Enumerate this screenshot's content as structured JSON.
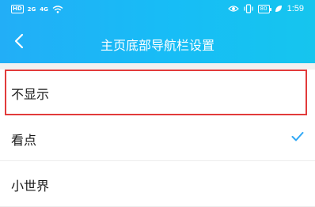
{
  "status_bar": {
    "hd_label": "HD",
    "sim1_signal": "2G",
    "sim2_signal": "4G",
    "battery": "80",
    "time": "1:59"
  },
  "header": {
    "title": "主页底部导航栏设置"
  },
  "options": [
    {
      "label": "不显示",
      "checked": false,
      "highlighted": true
    },
    {
      "label": "看点",
      "checked": true,
      "highlighted": false
    },
    {
      "label": "小世界",
      "checked": false,
      "highlighted": false
    }
  ],
  "colors": {
    "header_start": "#22aef7",
    "header_end": "#16c5ee",
    "check": "#2fa7f5",
    "highlight_border": "#e23b3b"
  }
}
